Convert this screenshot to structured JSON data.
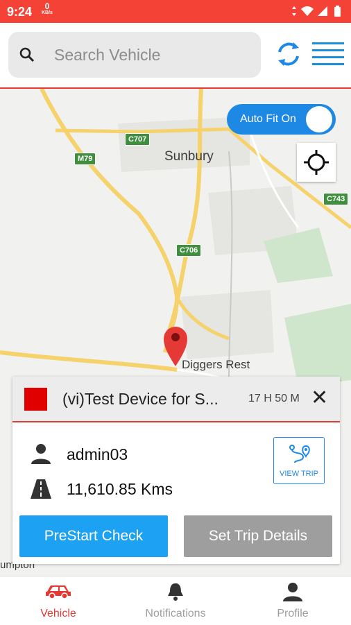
{
  "status_bar": {
    "time": "9:24",
    "net_speed": "0",
    "net_unit": "KB/s"
  },
  "search": {
    "placeholder": "Search Vehicle"
  },
  "map": {
    "labels": {
      "town1": "Sunbury",
      "town2": "Diggers Rest",
      "town3": "umpton"
    },
    "badges": {
      "c707": "C707",
      "m79": "M79",
      "c706": "C706",
      "c743": "C743"
    },
    "autofit_label": "Auto Fit On"
  },
  "panel": {
    "device_name": "(vi)Test Device for S...",
    "duration": "17 H 50 M",
    "user": "admin03",
    "distance": "11,610.85 Kms",
    "view_trip_label": "VIEW TRIP",
    "prestart_label": "PreStart Check",
    "settrip_label": "Set Trip Details"
  },
  "nav": {
    "vehicle": "Vehicle",
    "notifications": "Notifications",
    "profile": "Profile"
  },
  "colors": {
    "accent": "#e53935",
    "blue": "#1e88e5",
    "status_bar": "#f44336"
  }
}
